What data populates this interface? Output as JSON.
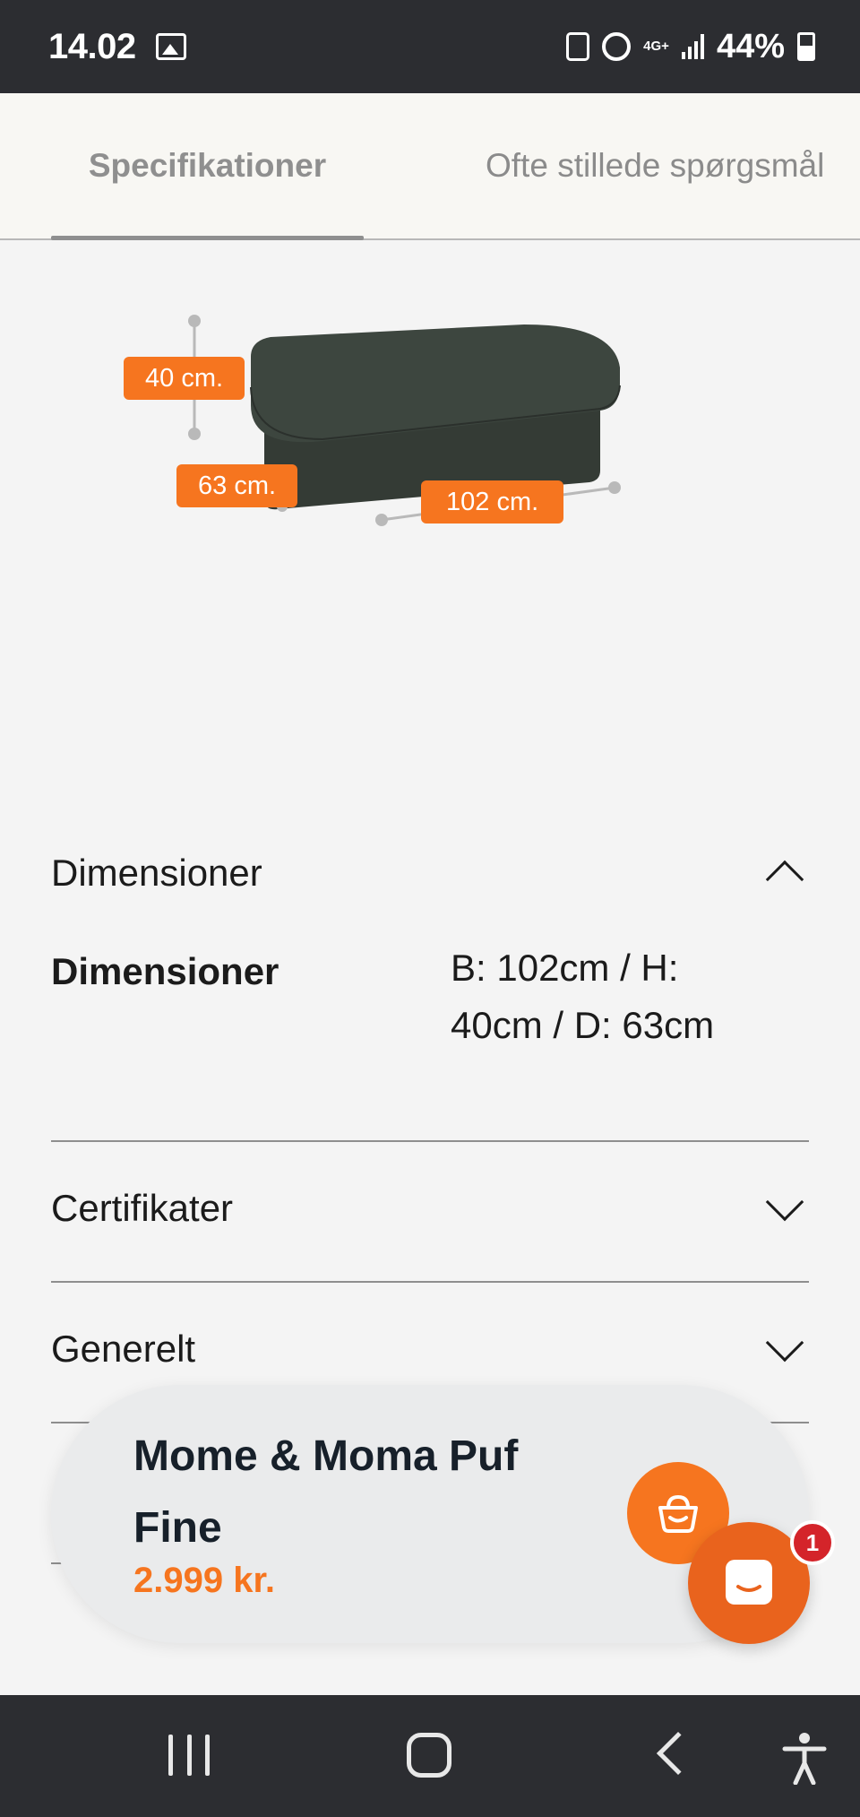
{
  "status_bar": {
    "time": "14.02",
    "network": "4G+",
    "battery": "44%"
  },
  "tabs": [
    {
      "label": "Specifikationer",
      "active": true
    },
    {
      "label": "Ofte stillede spørgsmål",
      "active": false
    }
  ],
  "product_image": {
    "height_label": "40 cm.",
    "depth_label": "63 cm.",
    "width_label": "102 cm.",
    "fabric_color": "#3b433c",
    "tag_color": "#f6751f"
  },
  "dimensions_section": {
    "header": "Dimensioner",
    "expanded": true,
    "spec_label": "Dimensioner",
    "spec_value": "B: 102cm / H: 40cm / D: 63cm"
  },
  "certificates_section": {
    "header": "Certifikater",
    "expanded": false
  },
  "general_section": {
    "header": "Generelt",
    "expanded": false
  },
  "cart_bar": {
    "product_name": "Mome & Moma Puf Fine",
    "price": "2.999 kr.",
    "accent_color": "#f6751f"
  },
  "chat": {
    "badge_count": "1"
  },
  "nav_bar": {
    "buttons": [
      "recent-apps",
      "home",
      "back",
      "accessibility"
    ]
  }
}
